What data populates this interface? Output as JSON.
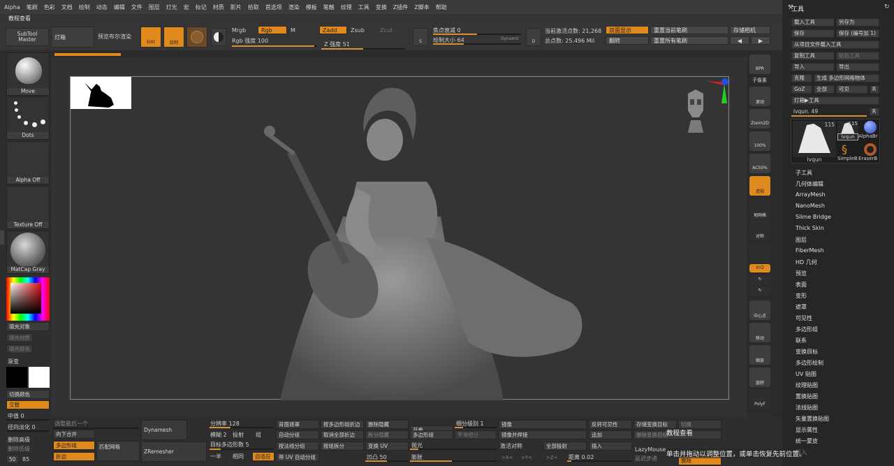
{
  "menu": [
    "Alpha",
    "笔刷",
    "色彩",
    "文档",
    "绘制",
    "动态",
    "编辑",
    "文件",
    "图层",
    "灯光",
    "宏",
    "标记",
    "材质",
    "影片",
    "拾取",
    "首选项",
    "渲染",
    "模板",
    "笔触",
    "纹理",
    "工具",
    "变换",
    "Z插件",
    "Z脚本",
    "帮助"
  ],
  "subbar": {
    "title": "教程查看"
  },
  "toolbar": {
    "subtool_master": "SubTool\nMaster",
    "lightbox": "灯箱",
    "preview_bpr": "预览布尔渲染",
    "edit": "Edit",
    "draw": "绘制",
    "mrgb": "Mrgb",
    "rgb": "Rgb",
    "m": "M",
    "rgb_intensity": "Rgb 强度 100",
    "zadd": "Zadd",
    "zsub": "Zsub",
    "zcut": "Zcut",
    "z_intensity": "Z 强度 51",
    "focal_shift": "焦点衰减 0",
    "draw_size": "绘制大小 64",
    "dynamic": "Dynamic",
    "active_points": "当前激活点数: 21,268",
    "total_points": "总点数: 25.496 Mil",
    "double_sided": "双面显示",
    "flip": "翻转",
    "reset_brush": "重置当前笔刷",
    "reset_all_brushes": "重置所有笔刷",
    "store_camera": "存储相机"
  },
  "left": {
    "move": "Move",
    "dots": "Dots",
    "alpha_off": "Alpha Off",
    "texture_off": "Texture Off",
    "matcap": "MatCap Gray",
    "fill_object": "填充对象",
    "fill_material": "填充材质",
    "fill_color": "填充颜色",
    "gradient": "渐变",
    "switch_color": "切换颜色",
    "alternate": "交替",
    "mid_value": "中值 0",
    "radial_fade": "径向淡化 0",
    "delete_higher": "删除高级",
    "delete_lower": "删除低级",
    "val_50": "50",
    "val_85": "85"
  },
  "colors": {
    "accent": "#e08a1e",
    "panel": "#262626",
    "canvas": "#343434"
  },
  "right_rail": [
    "BPR",
    "子像素",
    "滚动",
    "Zoom2D",
    "100%",
    "AC50%",
    "透视",
    "地网格",
    "对称",
    "",
    "XYZ",
    "",
    "",
    "中心点",
    "移动",
    "缩放",
    "旋转",
    "PolyF",
    "透明"
  ],
  "tool_panel": {
    "header": "工具",
    "load_tool": "载入工具",
    "save_as": "另存为",
    "save": "保存",
    "save_numbered": "保存 (编号加 1)",
    "load_from_project": "从项目文件载入工具",
    "copy_tool": "复制工具",
    "paste_tool": "粘贴工具",
    "import": "导入",
    "export": "导出",
    "clone": "克隆",
    "make_polymesh": "生成 多边形网格物体",
    "goz": "GoZ",
    "all": "全部",
    "visible": "可见",
    "r": "R",
    "lightbox_tool": "灯箱▶工具",
    "lvqun_slider": "lvqun. 49",
    "thumb_count": "115",
    "thumb_lvqun": "lvqun",
    "thumb_lvqun2": "lvqun",
    "thumb_count2": "115",
    "thumb_alpha": "AlphaBr",
    "thumb_simple": "SimpleB",
    "thumb_eraser": "EraserB",
    "list": [
      "子工具",
      "几何体编辑",
      "ArrayMesh",
      "NanoMesh",
      "Slime Bridge",
      "Thick Skin",
      "图层",
      "FiberMesh",
      "HD 几何",
      "预览",
      "表面",
      "变形",
      "遮罩",
      "可见性",
      "多边形组",
      "联系",
      "变换目标",
      "多边形绘制",
      "UV 贴图",
      "纹理贴图",
      "置换贴图",
      "法线贴图",
      "矢量置换贴图",
      "显示属性",
      "统一蒙皮",
      "导入"
    ]
  },
  "bottom": {
    "adjust_last": "调整最后一个",
    "merge_down": "向下合并",
    "polygroup": "多边形组",
    "crease": "折边",
    "dynamesh": "Dynamesh",
    "zremesher": "ZRemesher",
    "match_mesh": "匹配网格",
    "resolution": "分辨率 128",
    "blur": "模糊 2",
    "project": "投射",
    "group": "组",
    "target_poly": "目标多边形数 5",
    "half": "一半",
    "same": "相同",
    "adaptive": "自适应",
    "back_mask": "背面遮罩",
    "auto_group": "自动分组",
    "group_by_normals": "按法线分组",
    "uv_auto_group": "带 UV 自动分组",
    "split_by_polygroup": "按多边形组折边",
    "uncrease_all": "取消全部折边",
    "split_group": "按组拆分",
    "delete_hidden": "删除隐藏",
    "split_hidden": "拆分隐藏",
    "uv_transform": "变换 UV",
    "concave": "凹凸 50",
    "open": "开卷",
    "poly_group2": "多边形组",
    "polish": "抛光",
    "inflate": "膨胀",
    "subdiv_level": "细分级别 1",
    "smooth_subdiv": "平滑细分",
    "mirror": "镜像",
    "mirror_weld": "镜像并焊接",
    "activate_sym": "激活对称",
    "x_axis": ">X<",
    "y_axis": ">Y<",
    "z_axis": ">Z<",
    "all_project": "全部投射",
    "distance": "距离 0.02",
    "reverse_visible": "反转可见性",
    "append": "追加",
    "insert": "插入",
    "store_morph": "存储变换目标",
    "delete_morph": "删除变换目标",
    "switch": "切换",
    "lazymouse": "LazyMouse",
    "lazy_step": "延迟步进",
    "delete": "删除",
    "tutorial_title": "教程查看",
    "tutorial_hint": "单击并拖动以调整位置，或单击恢复先前位置。"
  }
}
